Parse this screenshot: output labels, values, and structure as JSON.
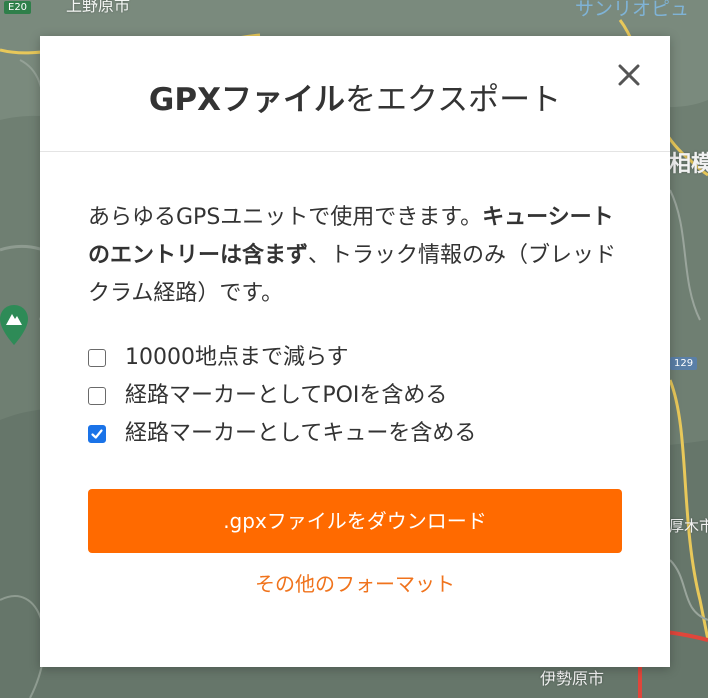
{
  "map": {
    "labels": {
      "top_left": "上野原市",
      "top_right": "サンリオピュ",
      "right_mid": "相模",
      "right_low": "厚木市",
      "bottom_right": "伊勢原市"
    },
    "badges": {
      "e20": "E20",
      "r129": "129"
    },
    "pin_icon": "mountain-pin-icon",
    "colors": {
      "road_red": "#e0463b",
      "road_yellow": "#e8c85a",
      "terrain": "#6f7f72"
    }
  },
  "modal": {
    "title_bold": "GPXファイル",
    "title_rest": "をエクスポート",
    "close_icon": "close-icon",
    "description": {
      "part1": "あらゆるGPSユニットで使用できます。",
      "bold": "キューシートのエントリーは含まず",
      "part2": "、トラック情報のみ（ブレッドクラム経路）です。"
    },
    "options": [
      {
        "label": "10000地点まで減らす",
        "checked": false
      },
      {
        "label": "経路マーカーとしてPOIを含める",
        "checked": false
      },
      {
        "label": "経路マーカーとしてキューを含める",
        "checked": true
      }
    ],
    "download_label": ".gpxファイルをダウンロード",
    "other_formats_label": "その他のフォーマット",
    "colors": {
      "accent": "#ff6a00",
      "link": "#f0731c",
      "checkbox_checked": "#1a73e8"
    }
  }
}
